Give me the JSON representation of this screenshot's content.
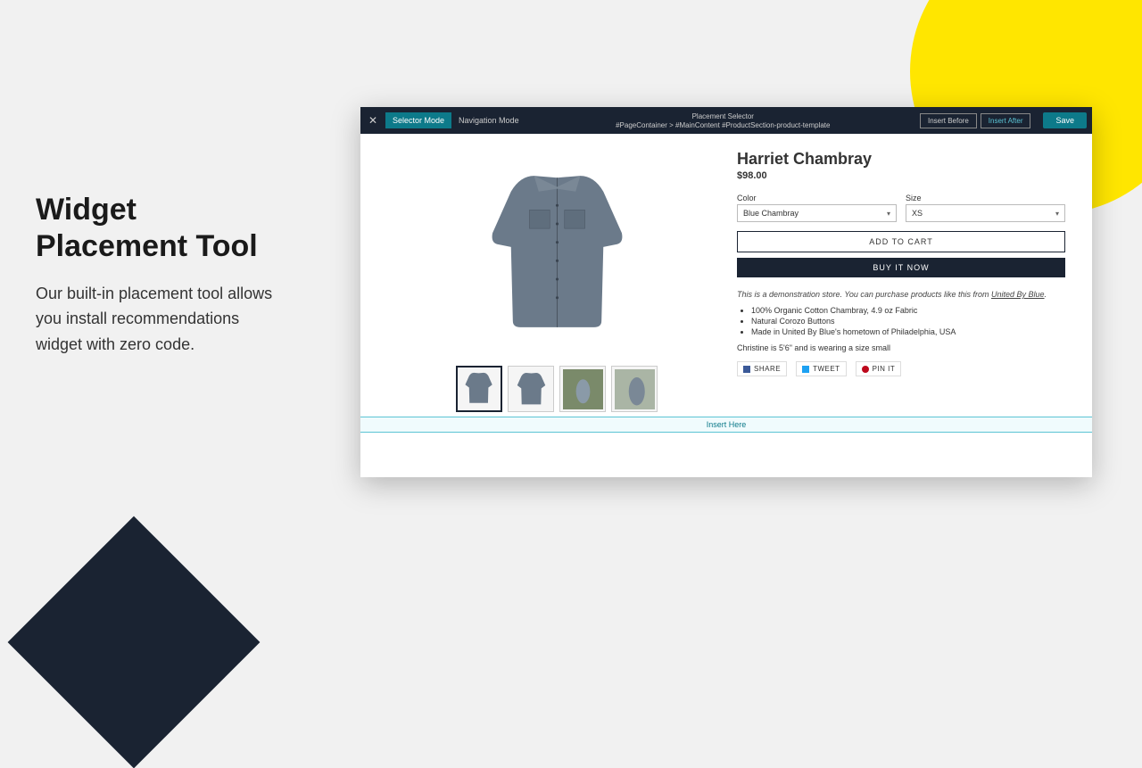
{
  "marketing": {
    "heading": "Widget Placement Tool",
    "body": "Our built-in placement tool allows you install recommendations widget with zero code."
  },
  "toolbar": {
    "selector_mode": "Selector Mode",
    "navigation_mode": "Navigation Mode",
    "center_title": "Placement Selector",
    "breadcrumb": "#PageContainer > #MainContent #ProductSection-product-template",
    "insert_before": "Insert Before",
    "insert_after": "Insert After",
    "save": "Save"
  },
  "product": {
    "title": "Harriet Chambray",
    "price": "$98.00",
    "color_label": "Color",
    "color_value": "Blue Chambray",
    "size_label": "Size",
    "size_value": "XS",
    "add_to_cart": "ADD TO CART",
    "buy_now": "BUY IT NOW",
    "demo_prefix": "This is a demonstration store. You can purchase products like this from ",
    "demo_link": "United By Blue",
    "demo_suffix": ".",
    "bullets": [
      "100% Organic Cotton Chambray, 4.9 oz Fabric",
      "Natural Corozo Buttons",
      "Made in United By Blue's hometown of Philadelphia, USA"
    ],
    "fit_note": "Christine is 5'6\" and is wearing a size small",
    "share": "SHARE",
    "tweet": "TWEET",
    "pin": "PIN IT"
  },
  "insert_here": "Insert Here"
}
